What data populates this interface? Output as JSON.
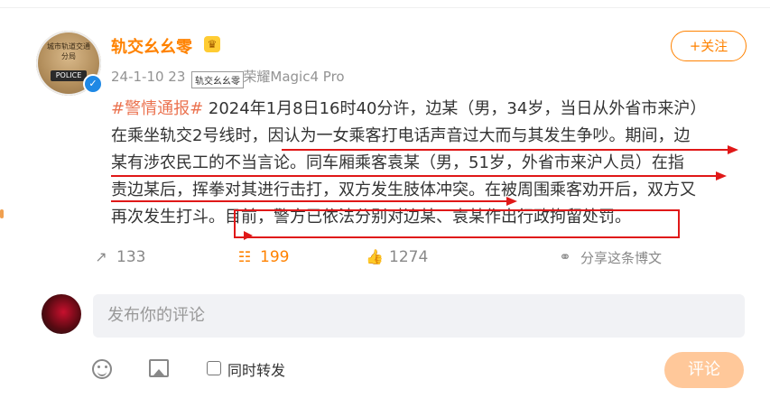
{
  "post": {
    "author": "轨交幺幺零",
    "meta_date": "24-1-10 23",
    "meta_device": "荣耀Magic4 Pro",
    "tooltip": "轨交幺幺零",
    "follow_label": "+关注",
    "avatar_text": "城市轨道交通分局",
    "avatar_police": "POLICE",
    "hashtag": "#警情通报#",
    "lines": [
      " 2024年1月8日16时40分许，边某（男，34岁，当日从外省市来沪）",
      "在乘坐轨交2号线时，因认为一女乘客打电话声音过大而与其发生争吵。期间，边",
      "某有涉农民工的不当言论。同车厢乘客袁某（男，51岁，外省市来沪人员）在指",
      "责边某后，挥拳对其进行击打，双方发生肢体冲突。在被周围乘客劝开后，双方又",
      "再次发生打斗。目前，警方已依法分别对边某、袁某作出行政拘留处罚。"
    ]
  },
  "actions": {
    "share_count": "133",
    "comment_count": "199",
    "like_count": "1274",
    "share_post_label": "分享这条博文"
  },
  "comment_box": {
    "placeholder": "发布你的评论",
    "repost_label": "同时转发",
    "submit_label": "评论"
  },
  "colors": {
    "accent": "#ff8200",
    "hashtag": "#eb7350",
    "annotation": "#e01818"
  }
}
